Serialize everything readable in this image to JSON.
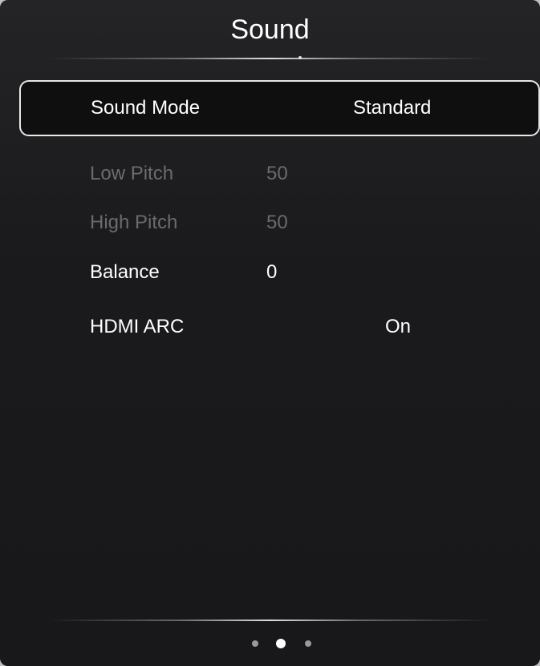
{
  "header": {
    "title": "Sound"
  },
  "settings": {
    "items": [
      {
        "label": "Sound Mode",
        "value": "Standard",
        "state": "selected"
      },
      {
        "label": "Low Pitch",
        "value": "50",
        "state": "disabled"
      },
      {
        "label": "High Pitch",
        "value": "50",
        "state": "disabled"
      },
      {
        "label": "Balance",
        "value": "0",
        "state": "enabled"
      },
      {
        "label": "HDMI ARC",
        "value": "On",
        "state": "enabled"
      }
    ]
  },
  "pager": {
    "page_count": 3,
    "current_page": 2
  },
  "colors": {
    "background": "#1b1b1d",
    "text": "#ffffff",
    "disabled_text": "#6b6b6d",
    "selection_border": "#e8e8e8"
  }
}
